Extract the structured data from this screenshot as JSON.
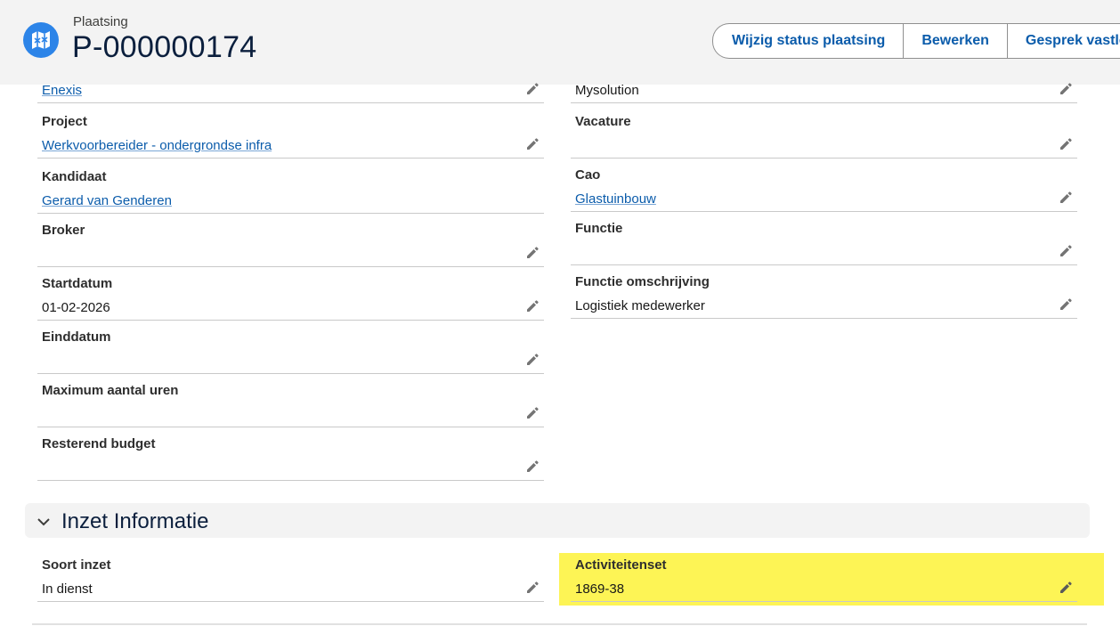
{
  "header": {
    "object_type": "Plaatsing",
    "record_title": "P-000000174",
    "actions": {
      "change_status": "Wijzig status plaatsing",
      "edit": "Bewerken",
      "log_call": "Gesprek vastleg"
    }
  },
  "fields": {
    "account": {
      "value": "Enexis"
    },
    "owner": {
      "value": "Mysolution"
    },
    "project": {
      "label": "Project",
      "value": "Werkvoorbereider - ondergrondse infra"
    },
    "vacature": {
      "label": "Vacature",
      "value": ""
    },
    "kandidaat": {
      "label": "Kandidaat",
      "value": "Gerard van Genderen"
    },
    "cao": {
      "label": "Cao",
      "value": "Glastuinbouw"
    },
    "broker": {
      "label": "Broker",
      "value": ""
    },
    "functie": {
      "label": "Functie",
      "value": ""
    },
    "startdatum": {
      "label": "Startdatum",
      "value": "01-02-2026"
    },
    "functie_omschrijving": {
      "label": "Functie omschrijving",
      "value": "Logistiek medewerker"
    },
    "einddatum": {
      "label": "Einddatum",
      "value": ""
    },
    "maximum_uren": {
      "label": "Maximum aantal uren",
      "value": ""
    },
    "resterend_budget": {
      "label": "Resterend budget",
      "value": ""
    }
  },
  "section": {
    "title": "Inzet Informatie"
  },
  "inzet": {
    "soort_inzet": {
      "label": "Soort inzet",
      "value": "In dienst"
    },
    "activiteitenset": {
      "label": "Activiteitenset",
      "value": "1869-38"
    }
  },
  "colors": {
    "brand_icon": "#2c84e8",
    "link": "#0b5cab",
    "highlight": "#fdf455",
    "header_bg": "#f3f3f3"
  },
  "icons": {
    "app": "placement-map-icon",
    "edit": "pencil-icon",
    "section_toggle": "chevron-down-icon"
  }
}
